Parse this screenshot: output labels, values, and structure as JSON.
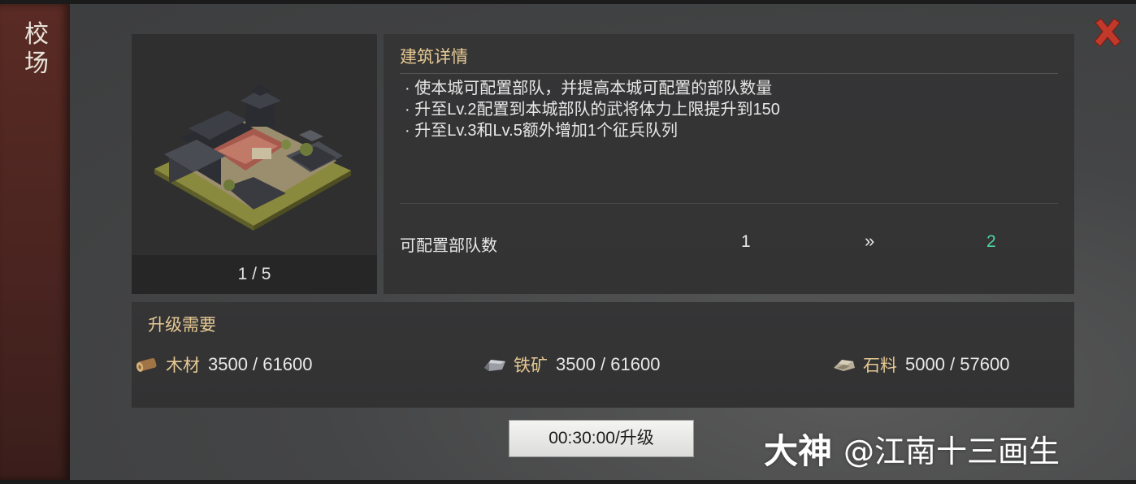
{
  "side_title": {
    "text": "校场"
  },
  "detail": {
    "title": "建筑详情",
    "bullets": [
      "· 使本城可配置部队，并提高本城可配置的部队数量",
      "· 升至Lv.2配置到本城部队的武将体力上限提升到150",
      "· 升至Lv.3和Lv.5额外增加1个征兵队列"
    ],
    "stat": {
      "label": "可配置部队数",
      "from": "1",
      "arrow": "»",
      "to": "2"
    }
  },
  "image_panel": {
    "page_indicator": "1 / 5"
  },
  "requirements": {
    "title": "升级需要",
    "resources": [
      {
        "icon": "wood-icon",
        "name": "木材",
        "value": "3500 / 61600"
      },
      {
        "icon": "iron-ore-icon",
        "name": "铁矿",
        "value": "3500 / 61600"
      },
      {
        "icon": "stone-icon",
        "name": "石料",
        "value": "5000 / 57600"
      }
    ]
  },
  "upgrade_button": {
    "label": "00:30:00/升级"
  },
  "watermark": {
    "logo": "大神",
    "user": "@江南十三画生"
  },
  "colors": {
    "accent_gold": "#e6c993",
    "positive_green": "#4fd6a0",
    "close_red": "#c0392b"
  }
}
